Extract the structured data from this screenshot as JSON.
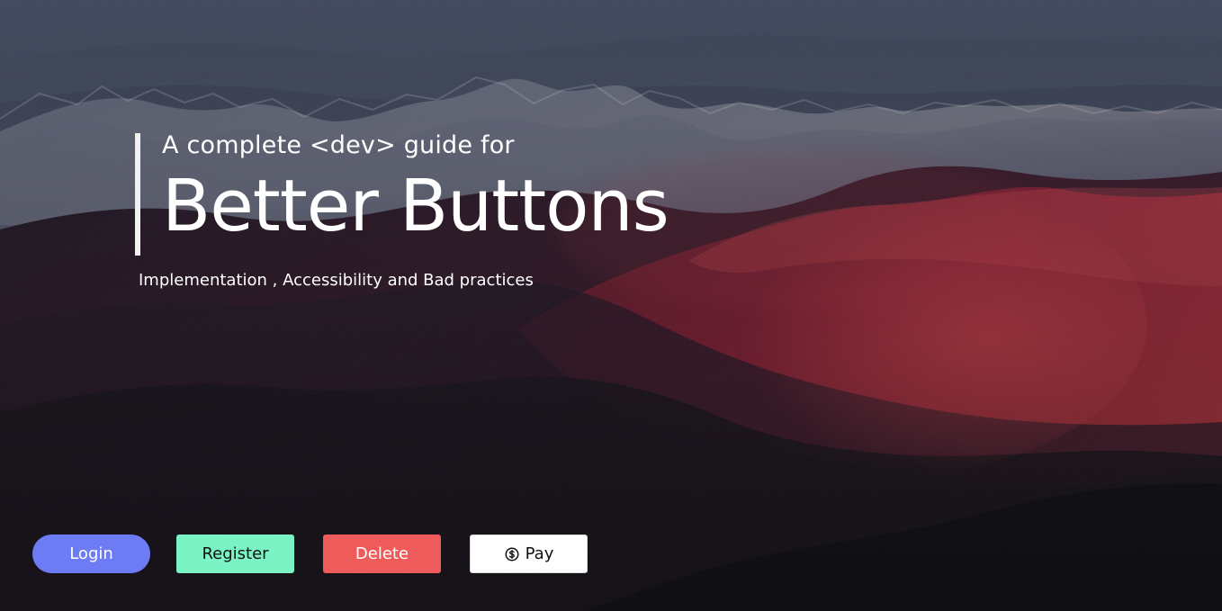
{
  "hero": {
    "kicker": "A complete <dev> guide for",
    "title": "Better Buttons",
    "subtitle": "Implementation , Accessibility and Bad practices"
  },
  "buttons": {
    "login": {
      "label": "Login",
      "background_color": "#6d7cf5"
    },
    "register": {
      "label": "Register",
      "background_color": "#7cf3c5"
    },
    "delete": {
      "label": "Delete",
      "background_color": "#ef5a5a"
    },
    "pay": {
      "label": "Pay",
      "icon": "dollar-coin-icon",
      "background_color": "#ffffff"
    }
  },
  "theme": {
    "text_color": "#ffffff",
    "accent_bar_color": "#f1f1f1"
  }
}
